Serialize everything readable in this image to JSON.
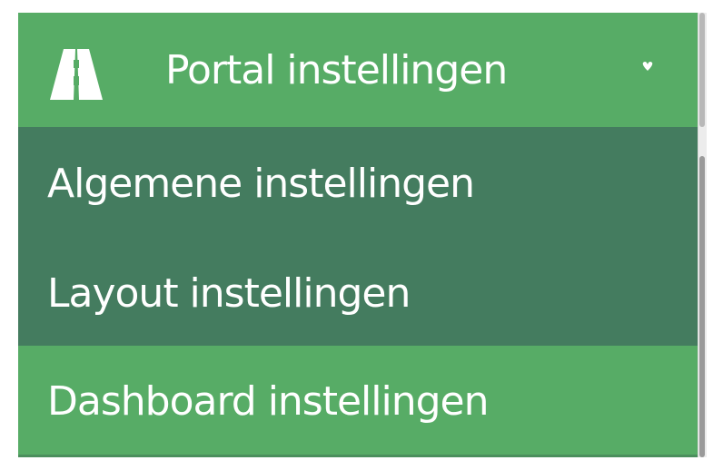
{
  "menu": {
    "header": {
      "label": "Portal instellingen",
      "logo_icon": "road-icon",
      "caret_icon": "chevron-down-icon"
    },
    "items": [
      {
        "label": "Algemene instellingen"
      },
      {
        "label": "Layout instellingen"
      },
      {
        "label": "Dashboard instellingen"
      }
    ]
  },
  "colors": {
    "header_background": "#57ac66",
    "submenu_background": "#447c5f",
    "text": "#ffffff"
  }
}
